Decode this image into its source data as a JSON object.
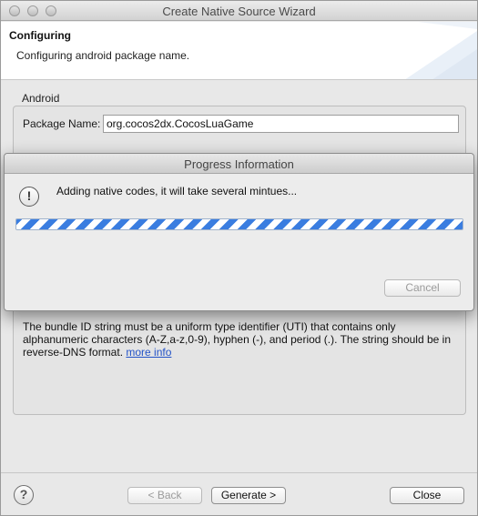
{
  "window": {
    "title": "Create Native Source Wizard"
  },
  "banner": {
    "title": "Configuring",
    "message": "Configuring android package name."
  },
  "android_group": {
    "label": "Android",
    "package_label": "Package Name:",
    "package_value": "org.cocos2dx.CocosLuaGame"
  },
  "info": {
    "text": "The bundle ID string must be a uniform type identifier (UTI) that contains only alphanumeric characters (A-Z,a-z,0-9), hyphen (-), and period (.). The string should be in reverse-DNS format.",
    "link": "more info"
  },
  "progress_dialog": {
    "title": "Progress Information",
    "message": "Adding native codes, it will take several mintues...",
    "progress": "indeterminate",
    "cancel_label": "Cancel"
  },
  "footer": {
    "help_label": "?",
    "back_label": "< Back",
    "generate_label": "Generate >",
    "close_label": "Close"
  },
  "icons": {
    "help": "help-icon",
    "warning": "warning-icon"
  }
}
